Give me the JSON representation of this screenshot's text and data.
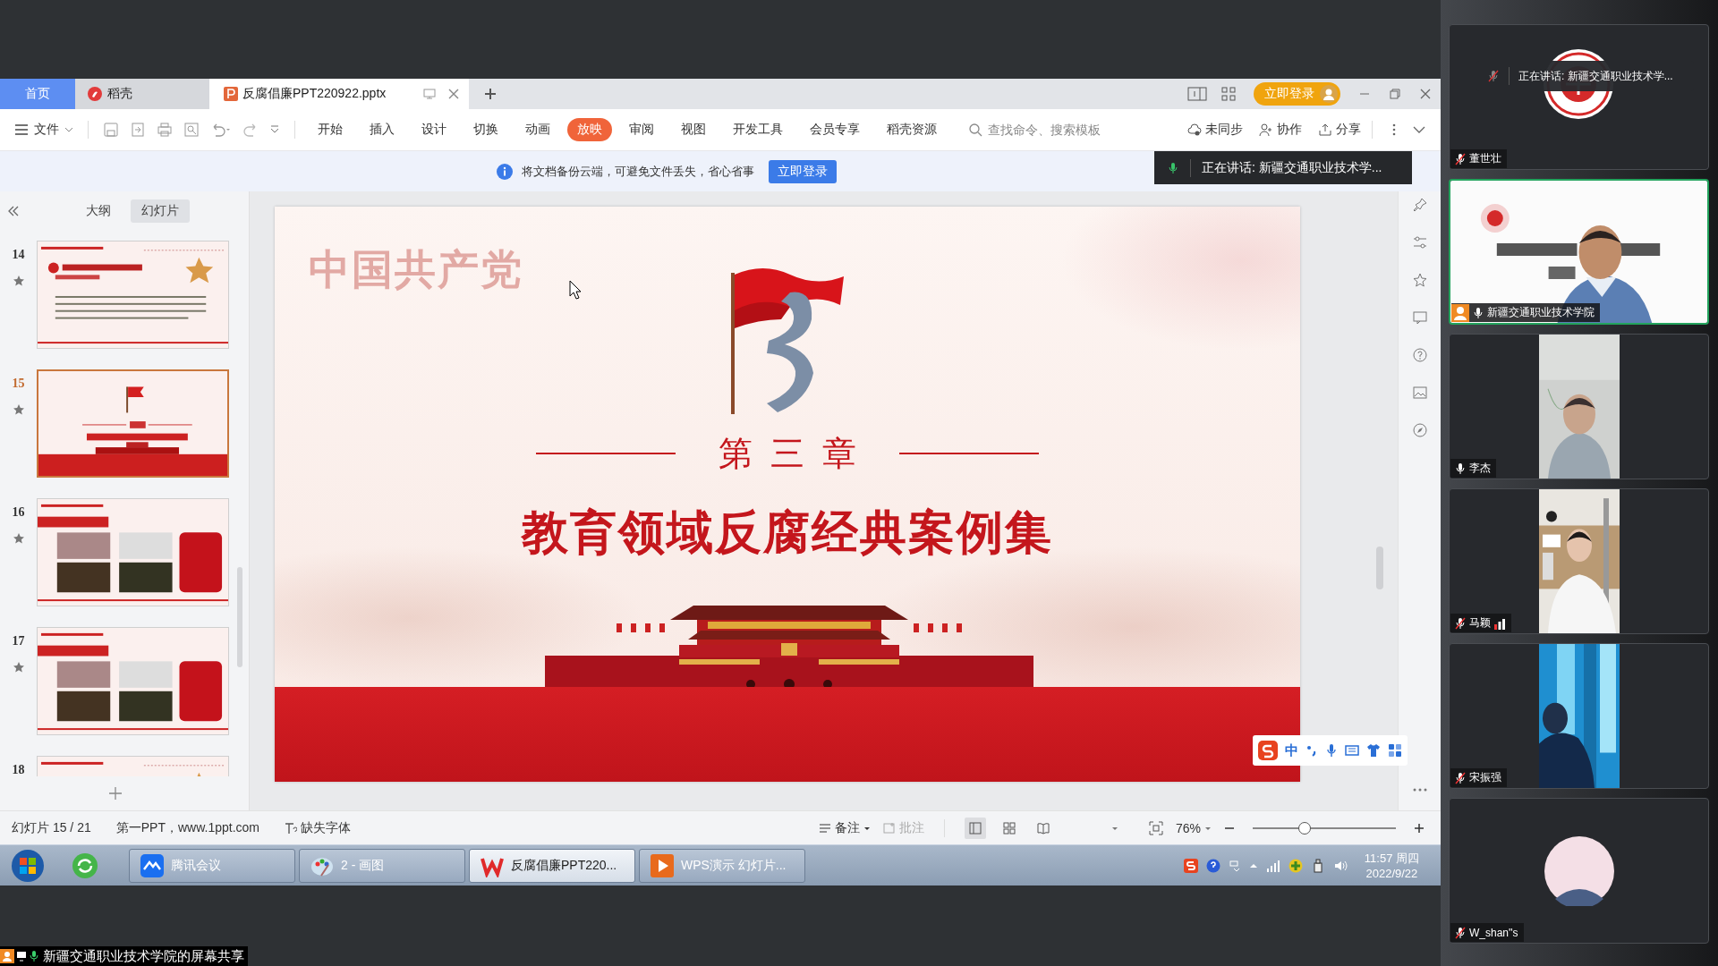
{
  "wps": {
    "tabs": [
      {
        "kind": "home",
        "label": "首页",
        "selected": false
      },
      {
        "kind": "app",
        "label": "稻壳",
        "selected": false
      },
      {
        "kind": "doc",
        "label": "反腐倡廉PPT220922.pptx",
        "selected": true
      }
    ],
    "login_button": "立即登录",
    "file_menu": "文件",
    "ribbon_tabs": [
      {
        "label": "开始",
        "selected": false
      },
      {
        "label": "插入",
        "selected": false
      },
      {
        "label": "设计",
        "selected": false
      },
      {
        "label": "切换",
        "selected": false
      },
      {
        "label": "动画",
        "selected": false
      },
      {
        "label": "放映",
        "selected": true
      },
      {
        "label": "审阅",
        "selected": false
      },
      {
        "label": "视图",
        "selected": false
      },
      {
        "label": "开发工具",
        "selected": false
      },
      {
        "label": "会员专享",
        "selected": false
      },
      {
        "label": "稻壳资源",
        "selected": false
      }
    ],
    "search": {
      "placeholder": "查找命令、搜索模板"
    },
    "actions": [
      {
        "kind": "sync",
        "label": "未同步"
      },
      {
        "kind": "collab",
        "label": "协作"
      },
      {
        "kind": "share",
        "label": "分享"
      }
    ],
    "notice": {
      "text": "将文档备份云端，可避免文件丢失，省心省事",
      "button": "立即登录"
    },
    "panel_tabs": [
      {
        "label": "大纲",
        "selected": false
      },
      {
        "label": "幻灯片",
        "selected": true
      }
    ],
    "slides": [
      {
        "number": "14",
        "kind": "text",
        "selected": false
      },
      {
        "number": "15",
        "kind": "title",
        "selected": true
      },
      {
        "number": "16",
        "kind": "photos",
        "selected": false
      },
      {
        "number": "17",
        "kind": "photos",
        "selected": false
      },
      {
        "number": "18",
        "kind": "text",
        "selected": false
      }
    ],
    "slide": {
      "watermark": "中国共产党",
      "chapter": "第三章",
      "title": "教育领域反腐经典案例集"
    },
    "status_bar": {
      "slide_count": "幻灯片 15 / 21",
      "template": "第一PPT，www.1ppt.com",
      "missing_fonts": "缺失字体",
      "notes": {
        "label": "备注",
        "disabled": false
      },
      "comments": {
        "label": "批注",
        "disabled": true
      },
      "views": [
        {
          "kind": "normal",
          "selected": true
        },
        {
          "kind": "sorter",
          "selected": false
        },
        {
          "kind": "reading",
          "selected": false
        }
      ],
      "zoom": {
        "label": "76%",
        "level": 0.36
      }
    },
    "ime": {
      "label": "中"
    }
  },
  "taskbar": {
    "buttons": [
      {
        "kind": "meeting",
        "label": "腾讯会议",
        "selected": false
      },
      {
        "kind": "paint",
        "label": "2 - 画图",
        "selected": false
      },
      {
        "kind": "wps",
        "label": "反腐倡廉PPT220...",
        "selected": true
      },
      {
        "kind": "slideshow",
        "label": "WPS演示 幻灯片...",
        "selected": false
      }
    ],
    "time": "11:57 周四",
    "date": "2022/9/22"
  },
  "meeting": {
    "speaking_toast": "正在讲话: 新疆交通职业技术学...",
    "participants": [
      {
        "name": "董世壮",
        "kind": "logo",
        "muted": true,
        "selected": false,
        "host": false,
        "signal": false,
        "toast": "正在讲话: 新疆交通职业技术学..."
      },
      {
        "name": "新疆交通职业技术学院",
        "kind": "video",
        "muted": false,
        "selected": true,
        "host": true,
        "signal": false
      },
      {
        "name": "李杰",
        "kind": "portrait",
        "muted": false,
        "selected": false,
        "host": false,
        "signal": false
      },
      {
        "name": "马颖",
        "kind": "portrait",
        "muted": true,
        "selected": false,
        "host": false,
        "signal": true
      },
      {
        "name": "宋振强",
        "kind": "portrait",
        "muted": true,
        "selected": false,
        "host": false,
        "signal": false
      },
      {
        "name": "W_shan''s",
        "kind": "avatar",
        "muted": true,
        "selected": false,
        "host": false,
        "signal": false
      }
    ],
    "share_label": "新疆交通职业技术学院的屏幕共享"
  }
}
